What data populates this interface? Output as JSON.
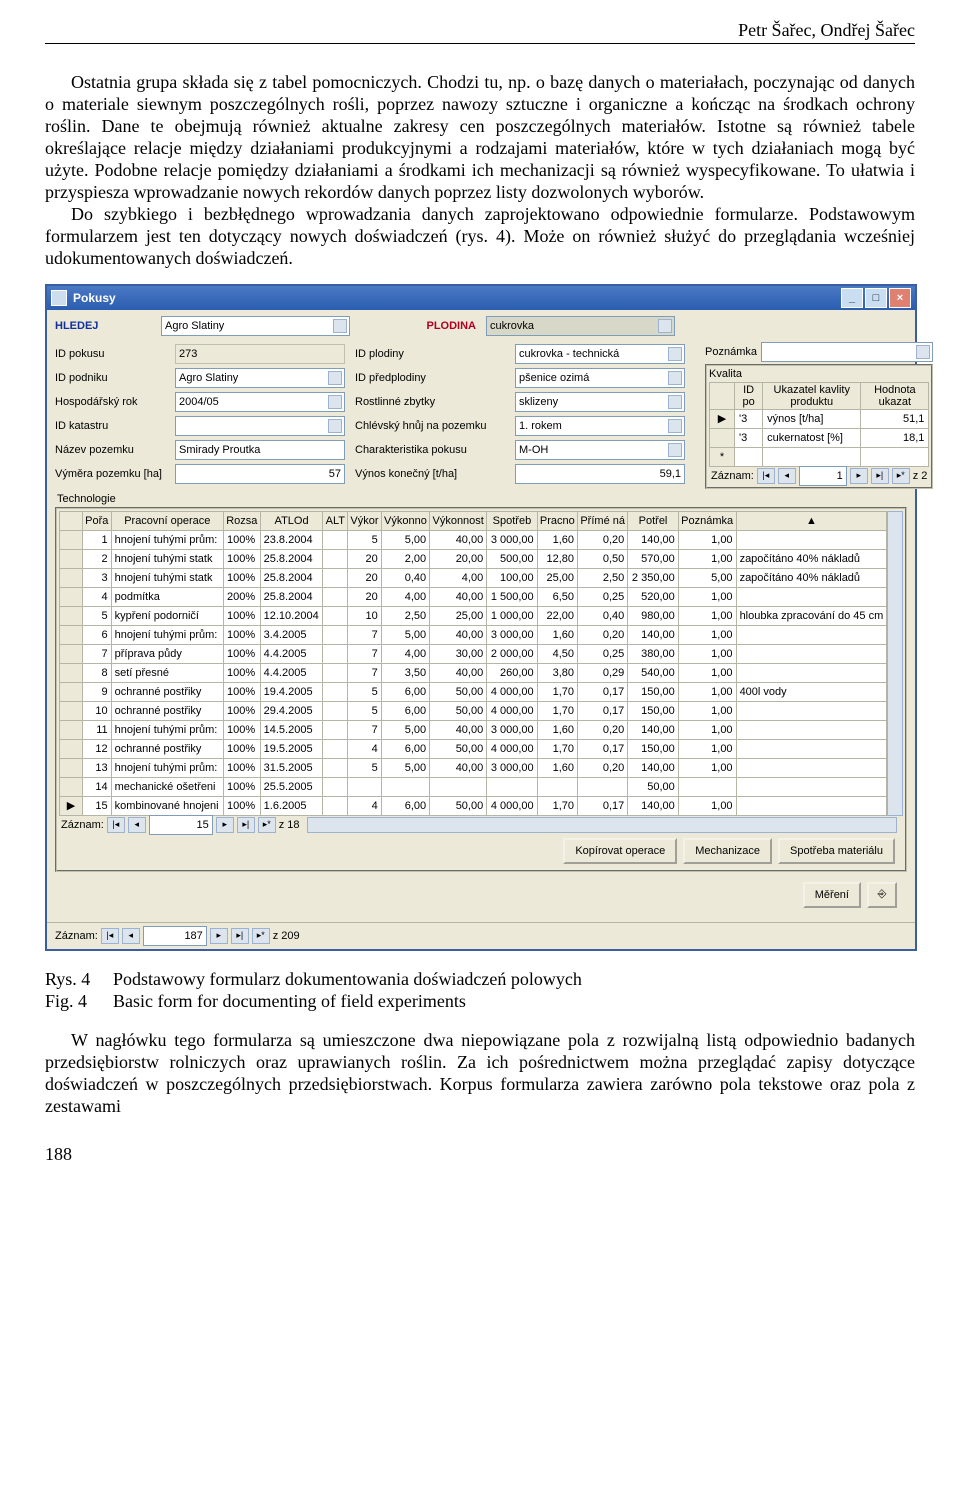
{
  "header": {
    "authors": "Petr Šařec, Ondřej Šařec"
  },
  "para1": "Ostatnia grupa składa się z tabel pomocniczych. Chodzi tu, np. o bazę danych o materiałach, poczynając od danych o materiale siewnym poszczególnych rośli, poprzez nawozy sztuczne i organiczne a kończąc na środkach ochrony roślin. Dane te obejmują również aktualne zakresy cen poszczególnych materiałów. Istotne są również tabele określające relacje między działaniami produkcyjnymi a rodzajami materiałów, które w tych działaniach mogą być użyte. Podobne relacje pomiędzy działaniami a środkami ich mechanizacji są również wyspecyfikowane. To ułatwia i przyspiesza wprowadzanie nowych rekordów danych poprzez listy dozwolonych wyborów.",
  "para2": "Do szybkiego i bezbłędnego wprowadzania danych zaprojektowano odpowiednie formularze. Podstawowym formularzem jest ten dotyczący nowych doświadczeń (rys. 4). Może on również służyć do przeglądania wcześniej udokumentowanych doświadczeń.",
  "fig": {
    "rys_label": "Rys. 4",
    "rys_text": "Podstawowy formularz dokumentowania  doświadczeń polowych",
    "fig_label": "Fig. 4",
    "fig_text": "Basic form for documenting of field experiments"
  },
  "para3": "W nagłówku tego formularza są umieszczone dwa niepowiązane pola z rozwijalną listą odpowiednio badanych przedsiębiorstw rolniczych oraz uprawianych roślin. Za ich pośrednictwem można przeglądać zapisy dotyczące doświadczeń w poszczególnych przedsiębiorstwach. Korpus formularza zawiera zarówno pola tekstowe oraz pola z zestawami",
  "pagenum": "188",
  "win": {
    "title": "Pokusy",
    "hledej": "HLEDEJ",
    "agro": "Agro Slatiny",
    "plodina": "PLODINA",
    "cukrovka": "cukrovka",
    "labels": {
      "id_pokusu": "ID pokusu",
      "id_podniku": "ID podniku",
      "hosp_rok": "Hospodářský rok",
      "id_katastru": "ID katastru",
      "nazev_pozemku": "Název pozemku",
      "vymera": "Výměra pozemku [ha]",
      "id_plodiny": "ID plodiny",
      "id_predplodiny": "ID předplodiny",
      "rost_zbytky": "Rostlinné zbytky",
      "chlev": "Chlévský hnůj na pozemku",
      "charakt": "Charakteristika pokusu",
      "vynos": "Výnos konečný [t/ha]",
      "poznamka": "Poznámka",
      "kvalita": "Kvalita",
      "idpo": "ID po",
      "ukazatel": "Ukazatel kavlity produktu",
      "hodnota": "Hodnota ukazat",
      "zaznam": "Záznam:",
      "z": "z",
      "technologie": "Technologie"
    },
    "vals": {
      "id_pokusu": "273",
      "id_podniku": "Agro Slatiny",
      "hosp_rok": "2004/05",
      "id_katastru": "",
      "nazev_pozemku": "Smirady Proutka",
      "vymera": "57",
      "id_plodiny": "cukrovka - technická",
      "id_predplodiny": "pšenice ozimá",
      "rost_zbytky": "sklizeny",
      "chlev": "1. rokem",
      "charakt": "M-OH",
      "vynos": "59,1",
      "poznamka": ""
    },
    "kvalita_rows": [
      {
        "idpo": "'3",
        "uk": "výnos [t/ha]",
        "val": "51,1"
      },
      {
        "idpo": "'3",
        "uk": "cukernatost [%]",
        "val": "18,1"
      }
    ],
    "kvalita_nav_count": "2",
    "tech_headers": [
      "Pořa",
      "Pracovní operace",
      "Rozsa",
      "ATLOd",
      "ALT",
      "Výkor",
      "Výkonno",
      "Výkonnost",
      "Spotřeb",
      "Pracno",
      "Přímé ná",
      "Potřel",
      "Poznámka"
    ],
    "tech_rows": [
      [
        "1",
        "hnojení tuhými prům:",
        "100%",
        "23.8.2004",
        "",
        "5",
        "5,00",
        "40,00",
        "3 000,00",
        "1,60",
        "0,20",
        "140,00",
        "1,00",
        ""
      ],
      [
        "2",
        "hnojení tuhými statk",
        "100%",
        "25.8.2004",
        "",
        "20",
        "2,00",
        "20,00",
        "500,00",
        "12,80",
        "0,50",
        "570,00",
        "1,00",
        "započítáno 40% nákladů"
      ],
      [
        "3",
        "hnojení tuhými statk",
        "100%",
        "25.8.2004",
        "",
        "20",
        "0,40",
        "4,00",
        "100,00",
        "25,00",
        "2,50",
        "2 350,00",
        "5,00",
        "započítáno 40% nákladů"
      ],
      [
        "4",
        "podmítka",
        "200%",
        "25.8.2004",
        "",
        "20",
        "4,00",
        "40,00",
        "1 500,00",
        "6,50",
        "0,25",
        "520,00",
        "1,00",
        ""
      ],
      [
        "5",
        "kypření podorničí",
        "100%",
        "12.10.2004",
        "",
        "10",
        "2,50",
        "25,00",
        "1 000,00",
        "22,00",
        "0,40",
        "980,00",
        "1,00",
        "hloubka zpracování do 45 cm"
      ],
      [
        "6",
        "hnojení tuhými prům:",
        "100%",
        "3.4.2005",
        "",
        "7",
        "5,00",
        "40,00",
        "3 000,00",
        "1,60",
        "0,20",
        "140,00",
        "1,00",
        ""
      ],
      [
        "7",
        "příprava půdy",
        "100%",
        "4.4.2005",
        "",
        "7",
        "4,00",
        "30,00",
        "2 000,00",
        "4,50",
        "0,25",
        "380,00",
        "1,00",
        ""
      ],
      [
        "8",
        "setí přesné",
        "100%",
        "4.4.2005",
        "",
        "7",
        "3,50",
        "40,00",
        "260,00",
        "3,80",
        "0,29",
        "540,00",
        "1,00",
        ""
      ],
      [
        "9",
        "ochranné postřiky",
        "100%",
        "19.4.2005",
        "",
        "5",
        "6,00",
        "50,00",
        "4 000,00",
        "1,70",
        "0,17",
        "150,00",
        "1,00",
        "400l vody"
      ],
      [
        "10",
        "ochranné postřiky",
        "100%",
        "29.4.2005",
        "",
        "5",
        "6,00",
        "50,00",
        "4 000,00",
        "1,70",
        "0,17",
        "150,00",
        "1,00",
        ""
      ],
      [
        "11",
        "hnojení tuhými prům:",
        "100%",
        "14.5.2005",
        "",
        "7",
        "5,00",
        "40,00",
        "3 000,00",
        "1,60",
        "0,20",
        "140,00",
        "1,00",
        ""
      ],
      [
        "12",
        "ochranné postřiky",
        "100%",
        "19.5.2005",
        "",
        "4",
        "6,00",
        "50,00",
        "4 000,00",
        "1,70",
        "0,17",
        "150,00",
        "1,00",
        ""
      ],
      [
        "13",
        "hnojení tuhými prům:",
        "100%",
        "31.5.2005",
        "",
        "5",
        "5,00",
        "40,00",
        "3 000,00",
        "1,60",
        "0,20",
        "140,00",
        "1,00",
        ""
      ],
      [
        "14",
        "mechanické ošetřeni",
        "100%",
        "25.5.2005",
        "",
        "",
        "",
        "",
        "",
        "",
        "",
        "50,00",
        "",
        ""
      ],
      [
        "15",
        "kombinované hnojeni",
        "100%",
        "1.6.2005",
        "",
        "4",
        "6,00",
        "50,00",
        "4 000,00",
        "1,70",
        "0,17",
        "140,00",
        "1,00",
        ""
      ]
    ],
    "tech_nav_pos": "15",
    "tech_nav_total": "18",
    "buttons": {
      "kopirovat": "Kopírovat operace",
      "mechanizace": "Mechanizace",
      "spotreba": "Spotřeba materiálu",
      "mereni": "Měření"
    },
    "outer_nav_pos": "187",
    "outer_nav_total": "209"
  }
}
